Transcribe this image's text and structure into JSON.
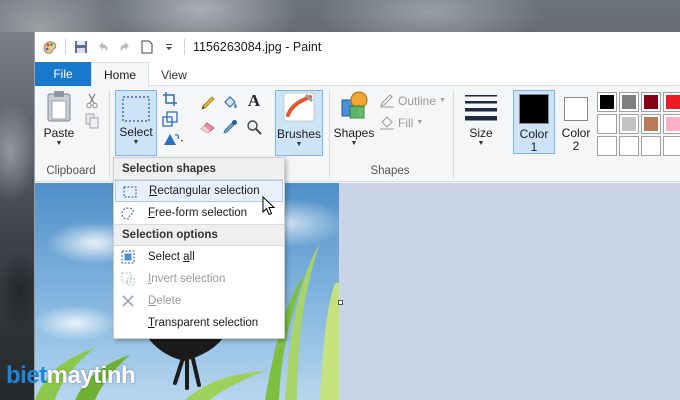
{
  "window": {
    "title": "1156263084.jpg - Paint"
  },
  "tabs": {
    "file": "File",
    "home": "Home",
    "view": "View"
  },
  "ribbon": {
    "clipboard": {
      "paste_label": "Paste",
      "group_label": "Clipboard"
    },
    "image": {
      "select_label": "Select"
    },
    "tools": {
      "brushes_label": "Brushes"
    },
    "shapes": {
      "shapes_label": "Shapes",
      "outline_label": "Outline",
      "fill_label": "Fill",
      "group_label": "Shapes"
    },
    "size": {
      "label": "Size"
    },
    "colors": {
      "color1_label": "Color",
      "color1_num": "1",
      "color2_label": "Color",
      "color2_num": "2",
      "color1_value": "#000000",
      "color2_value": "#ffffff",
      "palette": [
        "#000000",
        "#7f7f7f",
        "#880015",
        "#ed1c24",
        "#ffffff",
        "#c3c3c3",
        "#b97a57",
        "#ffaec9",
        "#ffffff",
        "#ffffff",
        "#ffffff",
        "#ffffff"
      ]
    }
  },
  "select_menu": {
    "section_shapes": "Selection shapes",
    "section_options": "Selection options",
    "rectangular_a": "R",
    "rectangular_b": "ectangular selection",
    "freeform_a": "F",
    "freeform_b": "ree-form selection",
    "selectall_a": "Select ",
    "selectall_b": "a",
    "selectall_c": "ll",
    "invert_a": "I",
    "invert_b": "nvert selection",
    "delete_a": "D",
    "delete_b": "elete",
    "transparent_a": "T",
    "transparent_b": "ransparent selection"
  },
  "watermark": {
    "part1": "biet",
    "part2": "maytinh"
  }
}
